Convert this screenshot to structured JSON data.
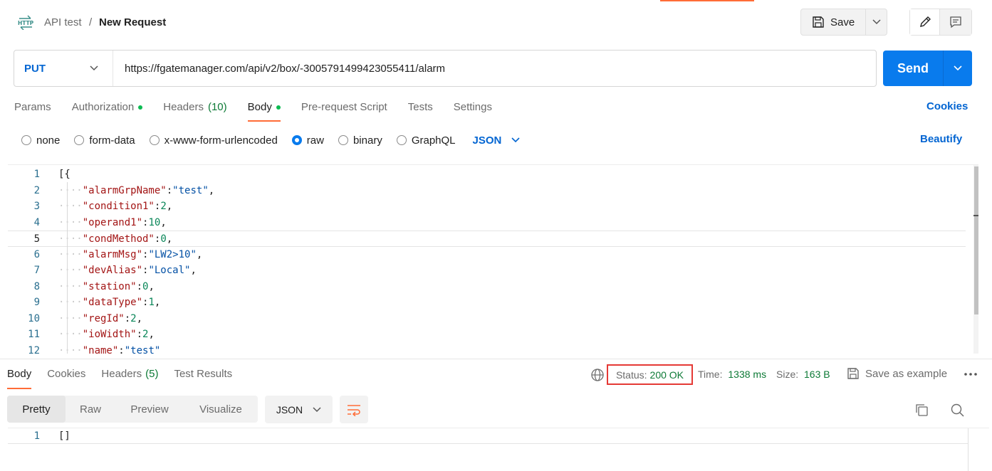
{
  "header": {
    "collection": "API test",
    "separator": "/",
    "request_name": "New Request",
    "save_label": "Save",
    "icons": {
      "request": "http-icon",
      "save": "save-icon",
      "edit": "pencil-icon",
      "comment": "comment-icon"
    }
  },
  "request": {
    "method": "PUT",
    "url": "https://fgatemanager.com/api/v2/box/-3005791499423055411/alarm",
    "send_label": "Send"
  },
  "request_tabs": [
    {
      "label": "Params",
      "count": "",
      "dot": false,
      "active": false
    },
    {
      "label": "Authorization",
      "count": "",
      "dot": true,
      "active": false
    },
    {
      "label": "Headers",
      "count": "(10)",
      "dot": false,
      "active": false
    },
    {
      "label": "Body",
      "count": "",
      "dot": true,
      "active": true
    },
    {
      "label": "Pre-request Script",
      "count": "",
      "dot": false,
      "active": false
    },
    {
      "label": "Tests",
      "count": "",
      "dot": false,
      "active": false
    },
    {
      "label": "Settings",
      "count": "",
      "dot": false,
      "active": false
    }
  ],
  "cookies_label": "Cookies",
  "body_types": [
    {
      "label": "none",
      "checked": false
    },
    {
      "label": "form-data",
      "checked": false
    },
    {
      "label": "x-www-form-urlencoded",
      "checked": false
    },
    {
      "label": "raw",
      "checked": true
    },
    {
      "label": "binary",
      "checked": false
    },
    {
      "label": "GraphQL",
      "checked": false
    }
  ],
  "body_format": "JSON",
  "beautify_label": "Beautify",
  "editor": {
    "current_line": 5,
    "lines": [
      {
        "n": "1",
        "parts": [
          [
            "p",
            "[{"
          ]
        ]
      },
      {
        "n": "2",
        "parts": [
          [
            "g",
            "····"
          ],
          [
            "k",
            "\"alarmGrpName\""
          ],
          [
            "p",
            ":"
          ],
          [
            "s",
            "\"test\""
          ],
          [
            "p",
            ","
          ]
        ]
      },
      {
        "n": "3",
        "parts": [
          [
            "g",
            "····"
          ],
          [
            "k",
            "\"condition1\""
          ],
          [
            "p",
            ":"
          ],
          [
            "n",
            "2"
          ],
          [
            "p",
            ","
          ]
        ]
      },
      {
        "n": "4",
        "parts": [
          [
            "g",
            "····"
          ],
          [
            "k",
            "\"operand1\""
          ],
          [
            "p",
            ":"
          ],
          [
            "n",
            "10"
          ],
          [
            "p",
            ","
          ]
        ]
      },
      {
        "n": "5",
        "parts": [
          [
            "g",
            "····"
          ],
          [
            "k",
            "\"condMethod\""
          ],
          [
            "p",
            ":"
          ],
          [
            "n",
            "0"
          ],
          [
            "p",
            ","
          ]
        ]
      },
      {
        "n": "6",
        "parts": [
          [
            "g",
            "····"
          ],
          [
            "k",
            "\"alarmMsg\""
          ],
          [
            "p",
            ":"
          ],
          [
            "s",
            "\"LW2>10\""
          ],
          [
            "p",
            ","
          ]
        ]
      },
      {
        "n": "7",
        "parts": [
          [
            "g",
            "····"
          ],
          [
            "k",
            "\"devAlias\""
          ],
          [
            "p",
            ":"
          ],
          [
            "s",
            "\"Local\""
          ],
          [
            "p",
            ","
          ]
        ]
      },
      {
        "n": "8",
        "parts": [
          [
            "g",
            "····"
          ],
          [
            "k",
            "\"station\""
          ],
          [
            "p",
            ":"
          ],
          [
            "n",
            "0"
          ],
          [
            "p",
            ","
          ]
        ]
      },
      {
        "n": "9",
        "parts": [
          [
            "g",
            "····"
          ],
          [
            "k",
            "\"dataType\""
          ],
          [
            "p",
            ":"
          ],
          [
            "n",
            "1"
          ],
          [
            "p",
            ","
          ]
        ]
      },
      {
        "n": "10",
        "parts": [
          [
            "g",
            "····"
          ],
          [
            "k",
            "\"regId\""
          ],
          [
            "p",
            ":"
          ],
          [
            "n",
            "2"
          ],
          [
            "p",
            ","
          ]
        ]
      },
      {
        "n": "11",
        "parts": [
          [
            "g",
            "····"
          ],
          [
            "k",
            "\"ioWidth\""
          ],
          [
            "p",
            ":"
          ],
          [
            "n",
            "2"
          ],
          [
            "p",
            ","
          ]
        ]
      },
      {
        "n": "12",
        "parts": [
          [
            "g",
            "····"
          ],
          [
            "k",
            "\"name\""
          ],
          [
            "p",
            ":"
          ],
          [
            "s",
            "\"test\""
          ]
        ]
      }
    ]
  },
  "response": {
    "tabs": [
      {
        "label": "Body",
        "count": "",
        "active": true
      },
      {
        "label": "Cookies",
        "count": "",
        "active": false
      },
      {
        "label": "Headers",
        "count": "(5)",
        "active": false
      },
      {
        "label": "Test Results",
        "count": "",
        "active": false
      }
    ],
    "status_label": "Status:",
    "status_value": "200 OK",
    "time_label": "Time:",
    "time_value": "1338 ms",
    "size_label": "Size:",
    "size_value": "163 B",
    "save_example_label": "Save as example",
    "view_modes": [
      {
        "label": "Pretty",
        "active": true
      },
      {
        "label": "Raw",
        "active": false
      },
      {
        "label": "Preview",
        "active": false
      },
      {
        "label": "Visualize",
        "active": false
      }
    ],
    "format": "JSON",
    "lines": [
      {
        "n": "1",
        "text": "[]"
      }
    ]
  },
  "colors": {
    "accent": "#ff6c37",
    "primary": "#097bed",
    "link": "#0265d2",
    "ok": "#0d7a36",
    "highlight_border": "#e53935"
  }
}
